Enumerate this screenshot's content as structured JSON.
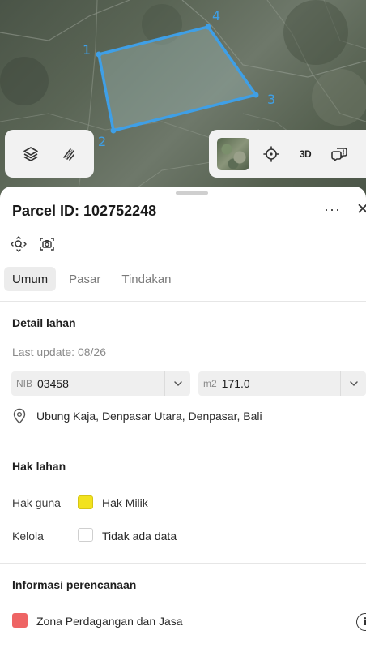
{
  "map": {
    "vertex_labels": [
      "1",
      "2",
      "3",
      "4"
    ],
    "parcel_color": "#3f9fe6",
    "controls_left": [
      "layers-icon",
      "measure-icon"
    ],
    "controls_right": [
      "satellite-thumbnail",
      "locate-icon",
      "3d-toggle",
      "feedback-icon"
    ],
    "label_3d": "3D"
  },
  "parcel": {
    "title": "Parcel ID: 102752248",
    "more": "···",
    "close": "✕"
  },
  "tabs": [
    "Umum",
    "Pasar",
    "Tindakan"
  ],
  "active_tab": "Umum",
  "detail": {
    "heading": "Detail lahan",
    "last_update": "Last update: 08/26",
    "nib_prefix": "NIB",
    "nib_value": "03458",
    "area_prefix": "m2",
    "area_value": "171.0",
    "address": "Ubung Kaja, Denpasar Utara, Denpasar, Bali"
  },
  "rights": {
    "heading": "Hak lahan",
    "rows": [
      {
        "label": "Hak guna",
        "value": "Hak Milik",
        "color": "#f2e21e"
      },
      {
        "label": "Kelola",
        "value": "Tidak ada data",
        "color": "#ffffff"
      }
    ]
  },
  "planning": {
    "heading": "Informasi perencanaan",
    "zone": "Zona Perdagangan dan Jasa",
    "zone_color": "#ee6464",
    "info": "i"
  }
}
